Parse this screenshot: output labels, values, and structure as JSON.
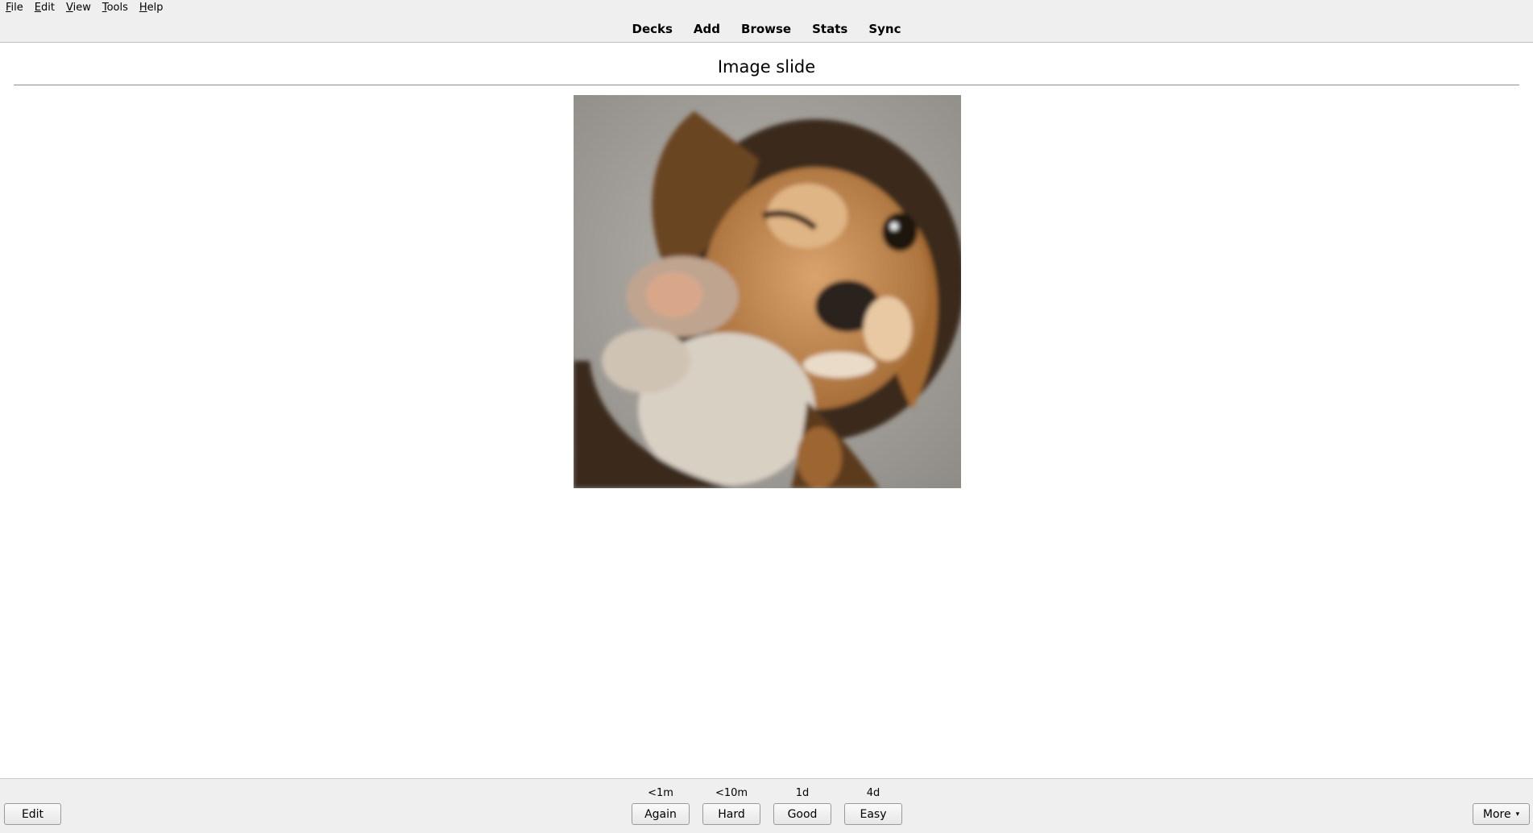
{
  "menubar": {
    "items": [
      {
        "accel": "F",
        "rest": "ile"
      },
      {
        "accel": "E",
        "rest": "dit"
      },
      {
        "accel": "V",
        "rest": "iew"
      },
      {
        "accel": "T",
        "rest": "ools"
      },
      {
        "accel": "H",
        "rest": "elp"
      }
    ]
  },
  "toolbar": {
    "decks": "Decks",
    "add": "Add",
    "browse": "Browse",
    "stats": "Stats",
    "sync": "Sync"
  },
  "card": {
    "title": "Image slide"
  },
  "bottom": {
    "edit_label": "Edit",
    "more_label": "More",
    "more_arrow": "▾",
    "answers": [
      {
        "interval": "<1m",
        "label": "Again"
      },
      {
        "interval": "<10m",
        "label": "Hard"
      },
      {
        "interval": "1d",
        "label": "Good"
      },
      {
        "interval": "4d",
        "label": "Easy"
      }
    ]
  }
}
